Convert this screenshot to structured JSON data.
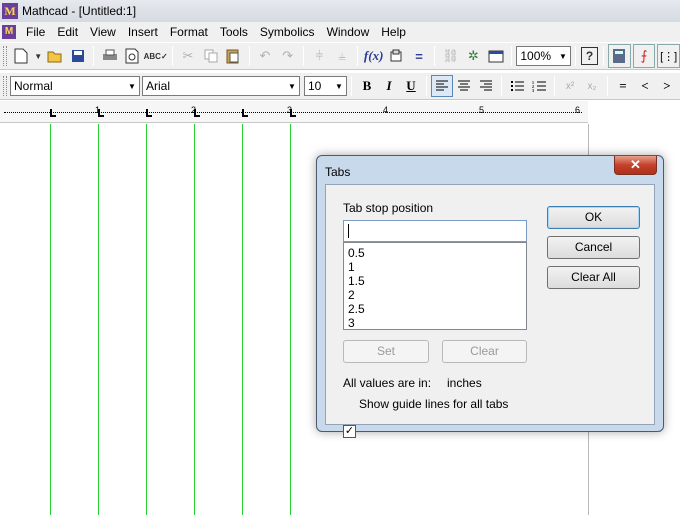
{
  "window": {
    "title": "Mathcad - [Untitled:1]",
    "logo": "M"
  },
  "menu": [
    "File",
    "Edit",
    "View",
    "Insert",
    "Format",
    "Tools",
    "Symbolics",
    "Window",
    "Help"
  ],
  "toolbar": {
    "zoom": "100%"
  },
  "format_bar": {
    "style": "Normal",
    "font": "Arial",
    "size": "10",
    "bold": "B",
    "italic": "I",
    "underline": "U",
    "eq": "=",
    "lt": "<",
    "gt": ">"
  },
  "ruler": {
    "marks": [
      "1",
      "2",
      "3",
      "4",
      "5",
      "6"
    ]
  },
  "dialog": {
    "title": "Tabs",
    "close": "✕",
    "tab_stop_label": "Tab stop position",
    "tab_stop_value": "",
    "tab_stops": [
      "0.5",
      "1",
      "1.5",
      "2",
      "2.5",
      "3"
    ],
    "ok": "OK",
    "cancel": "Cancel",
    "clear_all": "Clear All",
    "set": "Set",
    "clear": "Clear",
    "units_label": "All values are in:",
    "units_value": "inches",
    "guide_checkbox_label": "Show guide lines for all tabs",
    "guide_checked": true
  }
}
